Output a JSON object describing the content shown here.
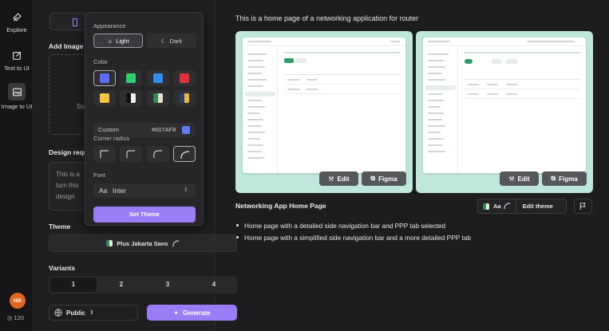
{
  "rail": {
    "items": [
      {
        "label": "Explore"
      },
      {
        "label": "Text to UI"
      },
      {
        "label": "Image to UI"
      }
    ],
    "avatar_initials": "HA",
    "credits": "120"
  },
  "panel": {
    "add_image_label": "Add Image",
    "upload_hint": "Su",
    "design_label": "Design requ",
    "design_text": [
      "This is a",
      "turn this",
      "design"
    ],
    "theme_label": "Theme",
    "theme_value": "Plus Jakarta Sans",
    "variants_label": "Variants",
    "variants": [
      "1",
      "2",
      "3",
      "4"
    ],
    "visibility": "Public",
    "generate_label": "Generate"
  },
  "popover": {
    "appearance_label": "Appearance",
    "light_label": "Light",
    "dark_label": "Dark",
    "color_label": "Color",
    "colors": [
      "#5b6ef5",
      "#2fcf6c",
      "#2f8ff0",
      "#e0303a",
      "#f5c242",
      "split-bw",
      "split-gc",
      "split-by"
    ],
    "custom_label": "Custom",
    "custom_hex": "#607AF8",
    "corner_label": "Corner radius",
    "font_label": "Font",
    "font_value": "Inter",
    "font_prefix": "Aa",
    "set_theme_label": "Set Theme"
  },
  "main": {
    "headline": "This is a home page of a networking application for router",
    "card_edit_label": "Edit",
    "card_figma_label": "Figma",
    "preview_title": "Networking App Home Page",
    "theme_chip_label": "Aa",
    "edit_theme_label": "Edit theme",
    "bullets": [
      "Home page with a detailed side navigation bar and PPP tab selected",
      "Home page with a simplified side navigation bar and a more detailed PPP tab"
    ]
  },
  "colors": {
    "accent": "#9a7cf6",
    "card_bg": "#bfe7db",
    "background": "#1d1d1f"
  }
}
